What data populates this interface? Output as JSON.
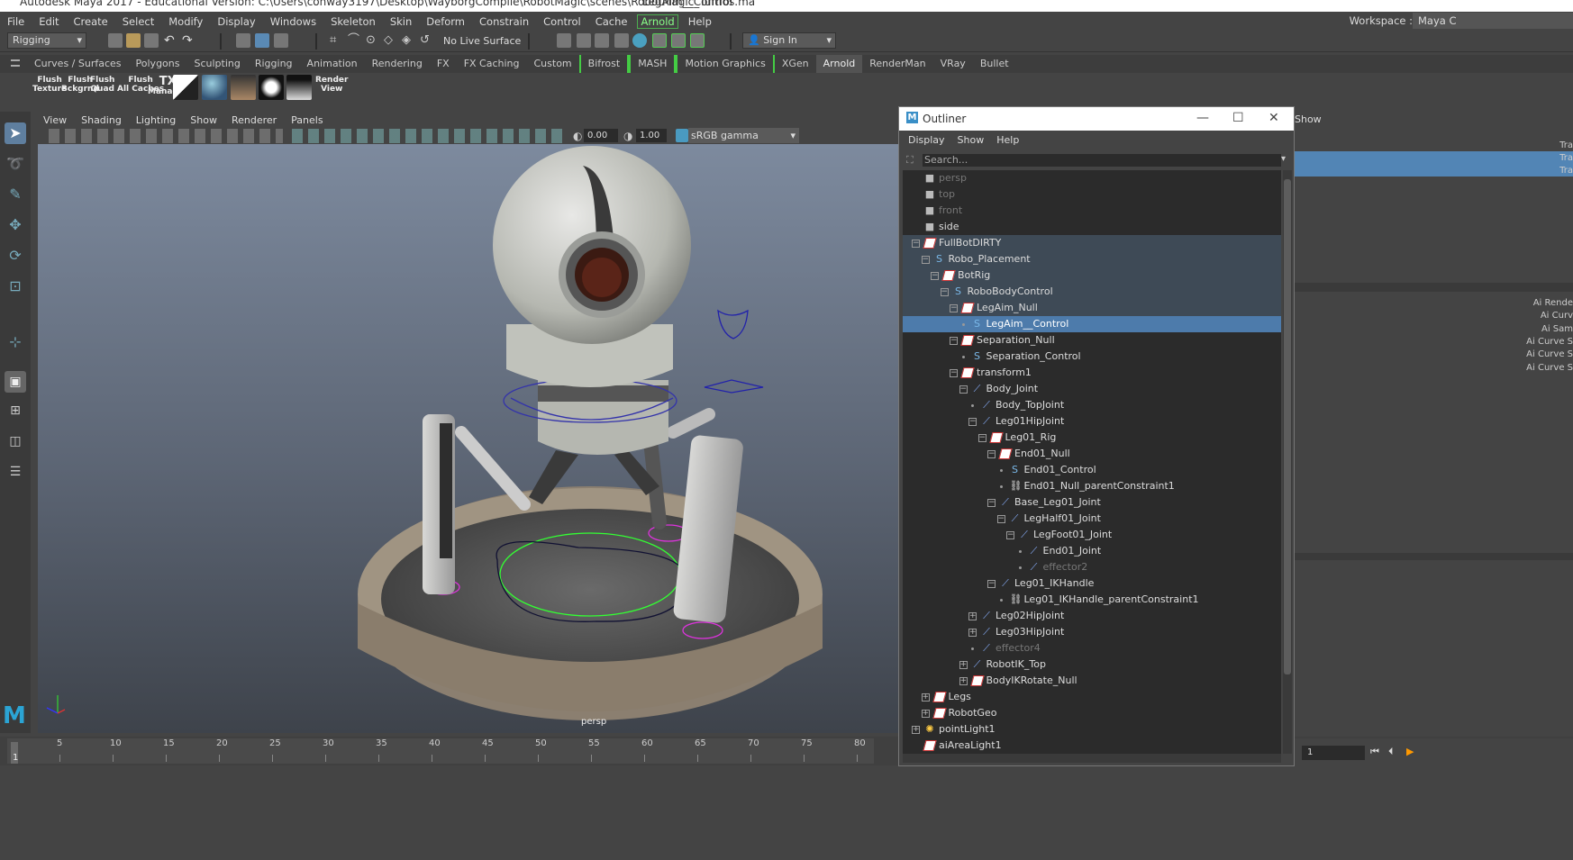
{
  "app": {
    "title": "Autodesk Maya 2017 - Educational Version: C:\\Users\\conway3197\\Desktop\\WayborgComplie\\RobotMagic\\scenes\\RobotMagic_Turnos.ma",
    "title2": "LegAim__Control"
  },
  "menubar": [
    "File",
    "Edit",
    "Create",
    "Select",
    "Modify",
    "Display",
    "Windows",
    "Skeleton",
    "Skin",
    "Deform",
    "Constrain",
    "Control",
    "Cache",
    "Arnold",
    "Help"
  ],
  "workspace": {
    "label": "Workspace :",
    "value": "Maya C"
  },
  "statusline": {
    "mode": "Rigging",
    "live_surface": "No Live Surface",
    "sign_in": "Sign In"
  },
  "shelf_tabs": [
    "Curves / Surfaces",
    "Polygons",
    "Sculpting",
    "Rigging",
    "Animation",
    "Rendering",
    "FX",
    "FX Caching",
    "Custom",
    "Bifrost",
    "MASH",
    "Motion Graphics",
    "XGen",
    "Arnold",
    "RenderMan",
    "VRay",
    "Bullet"
  ],
  "shelf_active": "Arnold",
  "shelf_buttons": [
    {
      "l1": "Flush",
      "l2": "Texture"
    },
    {
      "l1": "Flush",
      "l2": "Bckgrnd"
    },
    {
      "l1": "Flush",
      "l2": "Quad"
    },
    {
      "l1": "Flush",
      "l2": "All Caches"
    },
    {
      "l1": "TX",
      "l2": "Manager"
    }
  ],
  "render_view": {
    "l1": "Render",
    "l2": "View"
  },
  "viewport": {
    "menu": [
      "View",
      "Shading",
      "Lighting",
      "Show",
      "Renderer",
      "Panels"
    ],
    "exposure": "0.00",
    "gamma": "1.00",
    "colorspace": "sRGB gamma",
    "camera": "persp"
  },
  "timeline": {
    "ticks": [
      "5",
      "10",
      "15",
      "20",
      "25",
      "30",
      "35",
      "40",
      "45",
      "50",
      "55",
      "60",
      "65",
      "70",
      "75",
      "80"
    ],
    "current": "1",
    "range_start": "1"
  },
  "outliner": {
    "title": "Outliner",
    "menu": [
      "Display",
      "Show",
      "Help"
    ],
    "search_placeholder": "Search...",
    "rows": [
      {
        "label": "persp",
        "indent": 0,
        "icon": "cam",
        "exp": "",
        "state": "dim"
      },
      {
        "label": "top",
        "indent": 0,
        "icon": "cam",
        "exp": "",
        "state": "dim"
      },
      {
        "label": "front",
        "indent": 0,
        "icon": "cam",
        "exp": "",
        "state": "dim"
      },
      {
        "label": "side",
        "indent": 0,
        "icon": "cam",
        "exp": "",
        "state": ""
      },
      {
        "label": "FullBotDIRTY",
        "indent": 0,
        "icon": "group",
        "exp": "−",
        "state": "hl"
      },
      {
        "label": "Robo_Placement",
        "indent": 1,
        "icon": "curve",
        "exp": "−",
        "state": "hl"
      },
      {
        "label": "BotRig",
        "indent": 2,
        "icon": "group",
        "exp": "−",
        "state": "hl"
      },
      {
        "label": "RoboBodyControl",
        "indent": 3,
        "icon": "curve",
        "exp": "−",
        "state": "hl"
      },
      {
        "label": "LegAim_Null",
        "indent": 4,
        "icon": "group",
        "exp": "−",
        "state": "hl"
      },
      {
        "label": "LegAim__Control",
        "indent": 5,
        "icon": "curve",
        "exp": "",
        "state": "sel"
      },
      {
        "label": "Separation_Null",
        "indent": 4,
        "icon": "group",
        "exp": "−",
        "state": ""
      },
      {
        "label": "Separation_Control",
        "indent": 5,
        "icon": "curve",
        "exp": "",
        "state": ""
      },
      {
        "label": "transform1",
        "indent": 4,
        "icon": "group",
        "exp": "−",
        "state": ""
      },
      {
        "label": "Body_Joint",
        "indent": 5,
        "icon": "joint",
        "exp": "−",
        "state": ""
      },
      {
        "label": "Body_TopJoint",
        "indent": 6,
        "icon": "joint",
        "exp": "",
        "state": ""
      },
      {
        "label": "Leg01HipJoint",
        "indent": 6,
        "icon": "joint",
        "exp": "−",
        "state": ""
      },
      {
        "label": "Leg01_Rig",
        "indent": 7,
        "icon": "group",
        "exp": "−",
        "state": ""
      },
      {
        "label": "End01_Null",
        "indent": 8,
        "icon": "group",
        "exp": "−",
        "state": ""
      },
      {
        "label": "End01_Control",
        "indent": 9,
        "icon": "curve",
        "exp": "",
        "state": ""
      },
      {
        "label": "End01_Null_parentConstraint1",
        "indent": 9,
        "icon": "con",
        "exp": "",
        "state": ""
      },
      {
        "label": "Base_Leg01_Joint",
        "indent": 8,
        "icon": "joint",
        "exp": "−",
        "state": ""
      },
      {
        "label": "LegHalf01_Joint",
        "indent": 9,
        "icon": "joint",
        "exp": "−",
        "state": ""
      },
      {
        "label": "LegFoot01_Joint",
        "indent": 10,
        "icon": "joint",
        "exp": "−",
        "state": ""
      },
      {
        "label": "End01_Joint",
        "indent": 11,
        "icon": "joint",
        "exp": "",
        "state": ""
      },
      {
        "label": "effector2",
        "indent": 11,
        "icon": "joint",
        "exp": "",
        "state": "dim"
      },
      {
        "label": "Leg01_IKHandle",
        "indent": 8,
        "icon": "joint",
        "exp": "−",
        "state": ""
      },
      {
        "label": "Leg01_IKHandle_parentConstraint1",
        "indent": 9,
        "icon": "con",
        "exp": "",
        "state": ""
      },
      {
        "label": "Leg02HipJoint",
        "indent": 6,
        "icon": "joint",
        "exp": "+",
        "state": ""
      },
      {
        "label": "Leg03HipJoint",
        "indent": 6,
        "icon": "joint",
        "exp": "+",
        "state": ""
      },
      {
        "label": "effector4",
        "indent": 6,
        "icon": "joint",
        "exp": "",
        "state": "dim"
      },
      {
        "label": "RobotIK_Top",
        "indent": 5,
        "icon": "joint",
        "exp": "+",
        "state": ""
      },
      {
        "label": "BodyIKRotate_Null",
        "indent": 5,
        "icon": "group",
        "exp": "+",
        "state": ""
      },
      {
        "label": "Legs",
        "indent": 1,
        "icon": "group",
        "exp": "+",
        "state": ""
      },
      {
        "label": "RobotGeo",
        "indent": 1,
        "icon": "group",
        "exp": "+",
        "state": ""
      },
      {
        "label": "pointLight1",
        "indent": 0,
        "icon": "light",
        "exp": "+",
        "state": ""
      },
      {
        "label": "aiAreaLight1",
        "indent": 0,
        "icon": "group",
        "exp": "",
        "state": ""
      }
    ]
  },
  "attr_labels": [
    "Ai Rende",
    "Ai Curv",
    "Ai Sam",
    "Ai Curve S",
    "Ai Curve S",
    "Ai Curve S"
  ],
  "attr_tra": [
    "Tra",
    "Tra",
    "Tra"
  ],
  "attr_show": "Show"
}
